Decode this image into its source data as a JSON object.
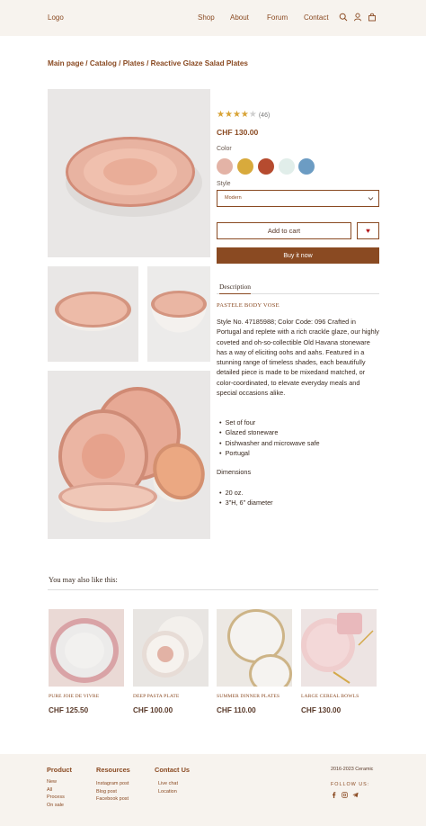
{
  "header": {
    "logo": "Logo",
    "nav": [
      "Shop",
      "About",
      "Forum",
      "Contact"
    ],
    "icons": [
      "search-icon",
      "user-icon",
      "bag-icon"
    ]
  },
  "breadcrumb": "Main page / Catalog / Plates /  Reactive Glaze Salad Plates",
  "product": {
    "rating_stars": 4,
    "rating_max": 5,
    "rating_count": "(46)",
    "price": "CHF 130.00",
    "color_label": "Color",
    "colors": [
      "#e3b3a6",
      "#d8aa3c",
      "#b64b2f",
      "#e1eeea",
      "#6c9cc3"
    ],
    "style_label": "Style",
    "style_value": "Modern",
    "add_to_cart": "Add to cart",
    "buy_now": "Buy it now",
    "tab": "Description",
    "subtitle": "PASTELE BODY VOSE",
    "description": "Style No. 47185988; Color Code: 096 Crafted in Portugal and replete with a rich crackle glaze, our highly coveted and oh-so-collectible Old Havana stoneware has a way of eliciting oohs and aahs. Featured in a stunning range of timeless shades, each beautifully detailed piece is made to be mixedand matched, or color-coordinated, to elevate everyday meals and special occasions alike.",
    "features": [
      "Set of four",
      "Glazed stoneware",
      "Dishwasher and microwave safe",
      "Portugal"
    ],
    "dimensions_label": "Dimensions",
    "dimensions": [
      "20 oz.",
      "3\"H, 6\" diameter"
    ]
  },
  "related": {
    "title": "You may also like this:",
    "items": [
      {
        "name": "PURE JOIE DE VIVRE",
        "price": "CHF 125.50"
      },
      {
        "name": "DEEP PASTA PLATE",
        "price": "CHF 100.00"
      },
      {
        "name": "SUMMER DINNER PLATES",
        "price": "CHF 110.00"
      },
      {
        "name": "LARGE CEREAL BOWLS",
        "price": "CHF 130.00"
      }
    ]
  },
  "footer": {
    "product": {
      "title": "Product",
      "links": [
        "New",
        "All",
        "Process",
        "On sale"
      ]
    },
    "resources": {
      "title": "Resources",
      "links": [
        "Instagram post",
        "Blog post",
        "Facebook post"
      ]
    },
    "contact": {
      "title": "Contact Us",
      "links": [
        "Live chat",
        "Location"
      ]
    },
    "copyright": "2016-2023  Ceramic",
    "follow": "FOLLOW US:",
    "social": [
      "facebook-icon",
      "instagram-icon",
      "telegram-icon"
    ]
  }
}
